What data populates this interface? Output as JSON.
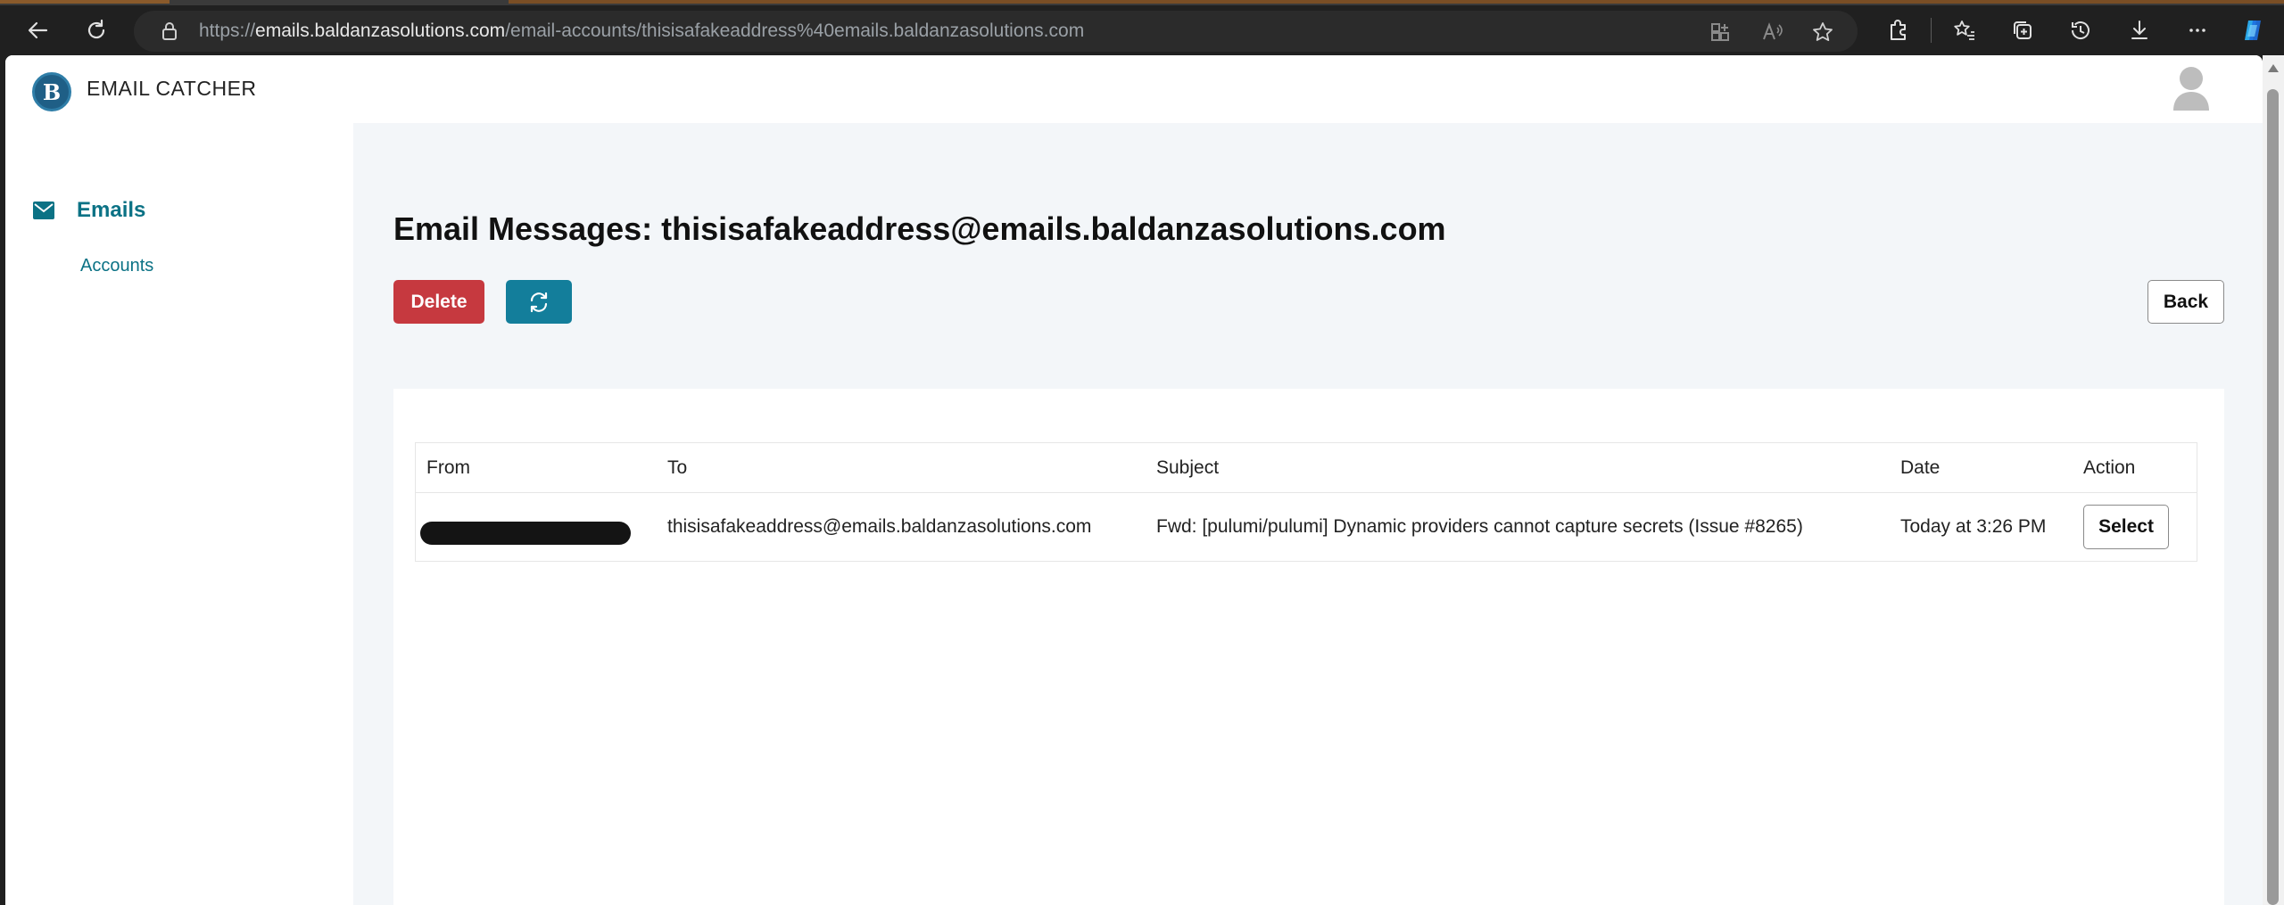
{
  "browser": {
    "url_host": "emails.baldanzasolutions.com",
    "url_path": "/email-accounts/thisisafakeaddress%40emails.baldanzasolutions.com",
    "url_scheme": "https://",
    "icons": [
      "back-icon",
      "refresh-icon",
      "lock-icon",
      "app-view-icon",
      "read-aloud-icon",
      "favorite-star-icon",
      "extensions-icon",
      "favorites-icon",
      "collections-icon",
      "history-icon",
      "downloads-icon",
      "more-icon",
      "copilot-icon"
    ]
  },
  "app": {
    "brand": "EMAIL CATCHER",
    "logo_letter": "B"
  },
  "sidebar": {
    "emails_label": "Emails",
    "accounts_label": "Accounts"
  },
  "main": {
    "title": "Email Messages: thisisafakeaddress@emails.baldanzasolutions.com",
    "delete_label": "Delete",
    "back_label": "Back",
    "table": {
      "headers": {
        "from": "From",
        "to": "To",
        "subject": "Subject",
        "date": "Date",
        "action": "Action"
      },
      "rows": [
        {
          "to": "thisisafakeaddress@emails.baldanzasolutions.com",
          "subject": "Fwd: [pulumi/pulumi] Dynamic providers cannot capture secrets (Issue #8265)",
          "date": "Today at 3:26 PM",
          "action_label": "Select"
        }
      ]
    }
  },
  "colors": {
    "accent": "#0b7285",
    "danger": "#c6393f",
    "refresh_button": "#137e9b",
    "main_bg": "#f3f6f9"
  }
}
